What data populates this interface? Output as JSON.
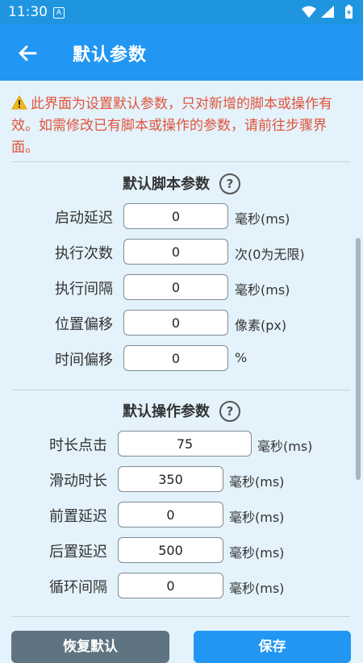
{
  "status_bar": {
    "time": "11:30",
    "notification_badge": "A",
    "icons": [
      "wifi-icon",
      "signal-icon",
      "battery-icon"
    ]
  },
  "app_bar": {
    "back_icon": "arrow-left-icon",
    "title": "默认参数"
  },
  "notice": {
    "icon": "warning-icon",
    "text": "此界面为设置默认参数，只对新增的脚本或操作有效。如需修改已有脚本或操作的参数，请前往步骤界面。"
  },
  "script_section": {
    "title": "默认脚本参数",
    "help": "?",
    "rows": [
      {
        "label": "启动延迟",
        "value": "0",
        "unit": "毫秒(ms)"
      },
      {
        "label": "执行次数",
        "value": "0",
        "unit": "次(0为无限)"
      },
      {
        "label": "执行间隔",
        "value": "0",
        "unit": "毫秒(ms)"
      },
      {
        "label": "位置偏移",
        "value": "0",
        "unit": "像素(px)"
      },
      {
        "label": "时间偏移",
        "value": "0",
        "unit": "%"
      }
    ]
  },
  "action_section": {
    "title": "默认操作参数",
    "help": "?",
    "rows": [
      {
        "label": "时长点击",
        "value": "75",
        "unit": "毫秒(ms)"
      },
      {
        "label": "滑动时长",
        "value": "350",
        "unit": "毫秒(ms)"
      },
      {
        "label": "前置延迟",
        "value": "0",
        "unit": "毫秒(ms)"
      },
      {
        "label": "后置延迟",
        "value": "500",
        "unit": "毫秒(ms)"
      },
      {
        "label": "循环间隔",
        "value": "0",
        "unit": "毫秒(ms)"
      }
    ]
  },
  "buttons": {
    "restore": "恢复默认",
    "save": "保存"
  },
  "colors": {
    "status_bar": "#1f95e0",
    "app_bar": "#2196f3",
    "background": "#e3f2fb",
    "warning_text": "#e2543b",
    "restore_button": "#5f7480",
    "save_button": "#2196f3"
  }
}
